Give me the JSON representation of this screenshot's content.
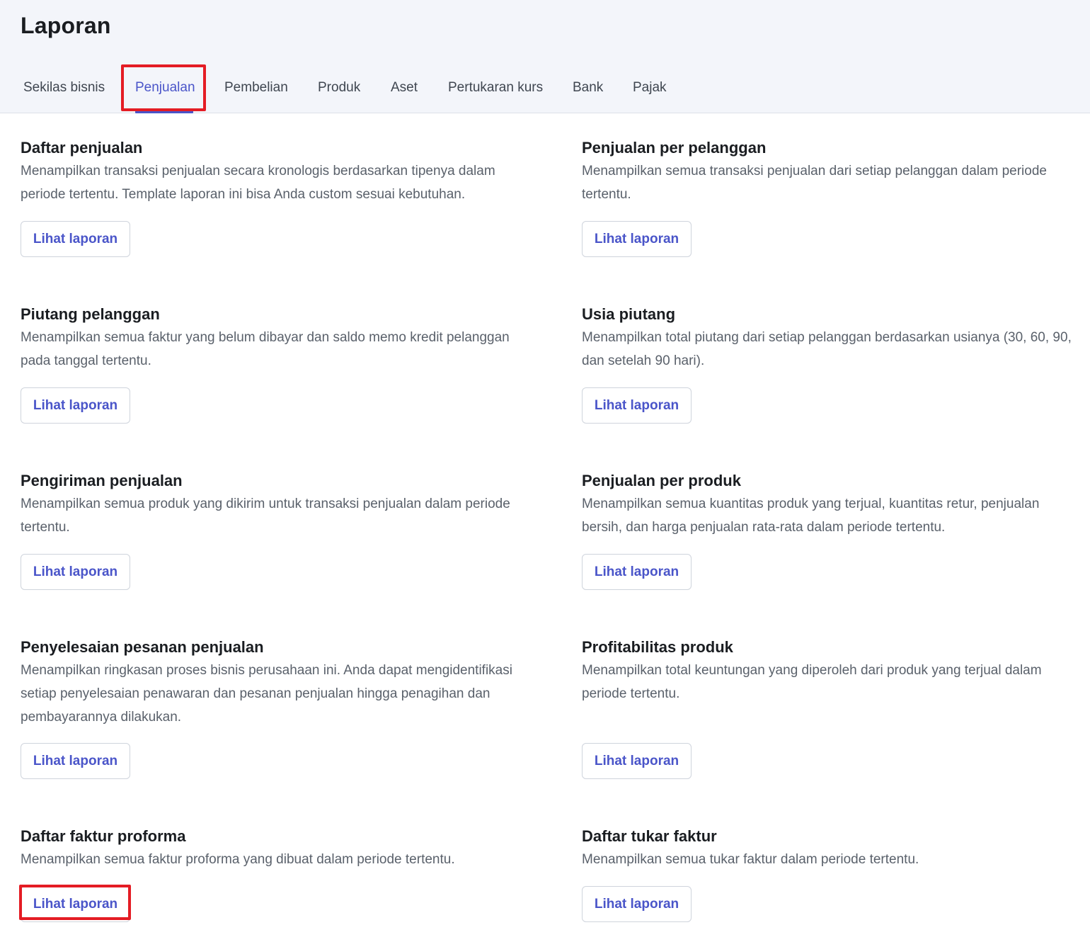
{
  "header": {
    "title": "Laporan",
    "tabs": [
      {
        "label": "Sekilas bisnis"
      },
      {
        "label": "Penjualan"
      },
      {
        "label": "Pembelian"
      },
      {
        "label": "Produk"
      },
      {
        "label": "Aset"
      },
      {
        "label": "Pertukaran kurs"
      },
      {
        "label": "Bank"
      },
      {
        "label": "Pajak"
      }
    ],
    "active_tab": "Penjualan"
  },
  "colors": {
    "accent": "#4a55c9",
    "highlight": "#e41c24",
    "header_bg": "#f3f5fa"
  },
  "reports": [
    {
      "title": "Daftar penjualan",
      "description": "Menampilkan transaksi penjualan secara kronologis berdasarkan tipenya dalam periode tertentu. Template laporan ini bisa Anda custom sesuai kebutuhan.",
      "button": "Lihat laporan"
    },
    {
      "title": "Penjualan per pelanggan",
      "description": "Menampilkan semua transaksi penjualan dari setiap pelanggan dalam periode tertentu.",
      "button": "Lihat laporan"
    },
    {
      "title": "Piutang pelanggan",
      "description": "Menampilkan semua faktur yang belum dibayar dan saldo memo kredit pelanggan pada tanggal tertentu.",
      "button": "Lihat laporan"
    },
    {
      "title": "Usia piutang",
      "description": "Menampilkan total piutang dari setiap pelanggan berdasarkan usianya (30, 60, 90, dan setelah 90 hari).",
      "button": "Lihat laporan"
    },
    {
      "title": "Pengiriman penjualan",
      "description": "Menampilkan semua produk yang dikirim untuk transaksi penjualan dalam periode tertentu.",
      "button": "Lihat laporan"
    },
    {
      "title": "Penjualan per produk",
      "description": "Menampilkan semua kuantitas produk yang terjual, kuantitas retur, penjualan bersih, dan harga penjualan rata-rata dalam periode tertentu.",
      "button": "Lihat laporan"
    },
    {
      "title": "Penyelesaian pesanan penjualan",
      "description": "Menampilkan ringkasan proses bisnis perusahaan ini. Anda dapat mengidentifikasi setiap penyelesaian penawaran dan pesanan penjualan hingga penagihan dan pembayarannya dilakukan.",
      "button": "Lihat laporan"
    },
    {
      "title": "Profitabilitas produk",
      "description": "Menampilkan total keuntungan yang diperoleh dari produk yang terjual dalam periode tertentu.",
      "button": "Lihat laporan"
    },
    {
      "title": "Daftar faktur proforma",
      "description": "Menampilkan semua faktur proforma yang dibuat dalam periode tertentu.",
      "button": "Lihat laporan"
    },
    {
      "title": "Daftar tukar faktur",
      "description": "Menampilkan semua tukar faktur dalam periode tertentu.",
      "button": "Lihat laporan"
    }
  ]
}
